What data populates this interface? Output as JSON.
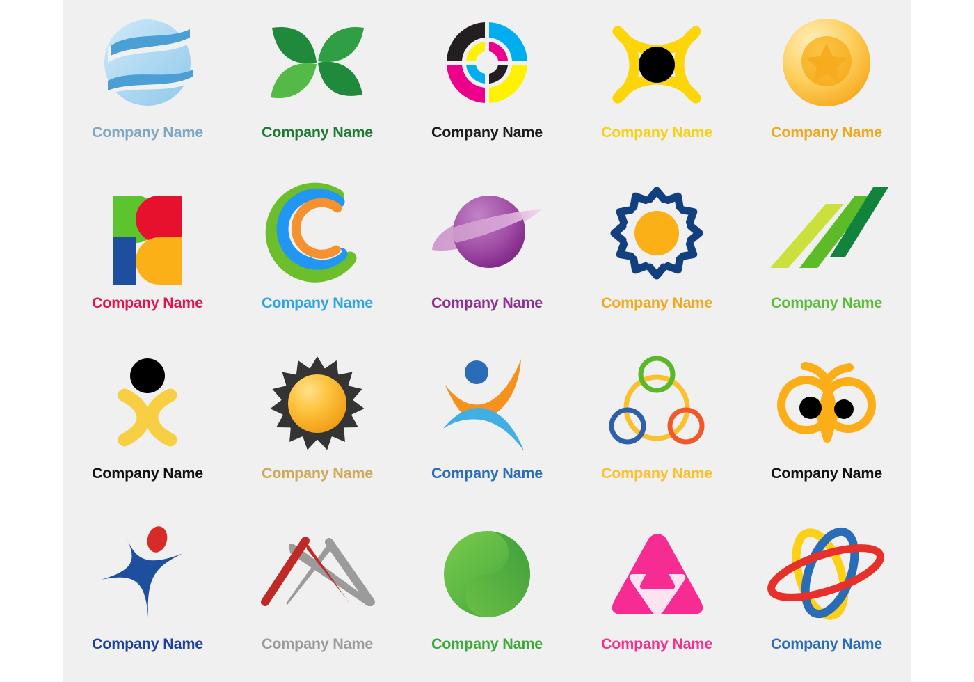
{
  "page": {
    "background_color": "#ffffff",
    "panel_color": "#f0f0f0",
    "columns": 5,
    "rows": 4,
    "total_logos": 20
  },
  "logos": [
    {
      "id": "sliced-sphere",
      "icon_name": "sliced-sphere-icon",
      "caption": "Company Name",
      "caption_color": "#7fa7c4",
      "colors": [
        "#bfe0f5",
        "#9fd0ee",
        "#4a9fd4",
        "#3f8fc4"
      ]
    },
    {
      "id": "four-leaf",
      "icon_name": "four-leaf-icon",
      "caption": "Company Name",
      "caption_color": "#1d7a35",
      "colors": [
        "#1f8a3c",
        "#2f9e44",
        "#55b948",
        "#3fae3f"
      ]
    },
    {
      "id": "cmyk-rings",
      "icon_name": "cmyk-concentric-rings-icon",
      "caption": "Company Name",
      "caption_color": "#1a1a1a",
      "colors": [
        "#231f20",
        "#00aeef",
        "#ec008c",
        "#fff200"
      ]
    },
    {
      "id": "eye-fish",
      "icon_name": "eye-icon",
      "caption": "Company Name",
      "caption_color": "#f7d117",
      "colors": [
        "#fcd50a",
        "#000000"
      ]
    },
    {
      "id": "star-coin",
      "icon_name": "star-coin-icon",
      "caption": "Company Name",
      "caption_color": "#f0a81e",
      "colors": [
        "#fde39a",
        "#fbbf34",
        "#f6a623",
        "#fcd367"
      ]
    },
    {
      "id": "four-petals",
      "icon_name": "four-petal-squares-icon",
      "caption": "Company Name",
      "caption_color": "#e2134a",
      "colors": [
        "#5cc42c",
        "#e8112d",
        "#1d4f9e",
        "#fbb018"
      ]
    },
    {
      "id": "triple-crescent",
      "icon_name": "triple-crescent-icon",
      "caption": "Company Name",
      "caption_color": "#2ba3e8",
      "colors": [
        "#6cbe2a",
        "#2196f3",
        "#f5922f"
      ]
    },
    {
      "id": "ringed-planet",
      "icon_name": "ringed-planet-icon",
      "caption": "Company Name",
      "caption_color": "#8e2f93",
      "colors": [
        "#a44fa8",
        "#8b2f90",
        "#d79ad4"
      ]
    },
    {
      "id": "chevron-sun",
      "icon_name": "chevron-sun-icon",
      "caption": "Company Name",
      "caption_color": "#f0a81e",
      "colors": [
        "#12407f",
        "#fbb018"
      ]
    },
    {
      "id": "diagonal-bars",
      "icon_name": "ascending-diagonal-bars-icon",
      "caption": "Company Name",
      "caption_color": "#5cbb3a",
      "colors": [
        "#cbe03c",
        "#5cbb26",
        "#12833c"
      ]
    },
    {
      "id": "arc-person",
      "icon_name": "person-arcs-icon",
      "caption": "Company Name",
      "caption_color": "#111111",
      "colors": [
        "#000000",
        "#f8ce43"
      ]
    },
    {
      "id": "sun-burst",
      "icon_name": "sunburst-icon",
      "caption": "Company Name",
      "caption_color": "#cfa85a",
      "colors": [
        "#343434",
        "#fcc63a",
        "#f5a21b"
      ]
    },
    {
      "id": "dancer",
      "icon_name": "dancing-figure-icon",
      "caption": "Company Name",
      "caption_color": "#2b6cb8",
      "colors": [
        "#2b6cb8",
        "#f5921e",
        "#41aee4"
      ]
    },
    {
      "id": "three-rings",
      "icon_name": "interlocking-rings-icon",
      "caption": "Company Name",
      "caption_color": "#fbc02d",
      "colors": [
        "#fbc02d",
        "#5cb82b",
        "#2f5fa8",
        "#f1592a"
      ]
    },
    {
      "id": "owl",
      "icon_name": "owl-face-icon",
      "caption": "Company Name",
      "caption_color": "#111111",
      "colors": [
        "#fbae17",
        "#000000"
      ]
    },
    {
      "id": "star-figure",
      "icon_name": "star-figure-icon",
      "caption": "Company Name",
      "caption_color": "#1d3f9e",
      "colors": [
        "#1d4f9e",
        "#d62b28"
      ]
    },
    {
      "id": "twin-peaks",
      "icon_name": "mountain-peaks-icon",
      "caption": "Company Name",
      "caption_color": "#9b9b9b",
      "colors": [
        "#c02a26",
        "#9b9b9b"
      ]
    },
    {
      "id": "green-yin-yang",
      "icon_name": "green-sphere-icon",
      "caption": "Company Name",
      "caption_color": "#3aa93a",
      "colors": [
        "#66c044",
        "#3da83f",
        "#2f9d3c"
      ]
    },
    {
      "id": "pink-triangles",
      "icon_name": "nested-triangles-icon",
      "caption": "Company Name",
      "caption_color": "#f2308e",
      "colors": [
        "#f62c93",
        "#fde2ef"
      ]
    },
    {
      "id": "atom-orbits",
      "icon_name": "atom-orbits-icon",
      "caption": "Company Name",
      "caption_color": "#2b6cb8",
      "colors": [
        "#2b6cb8",
        "#fcd014",
        "#e8302a"
      ]
    }
  ]
}
